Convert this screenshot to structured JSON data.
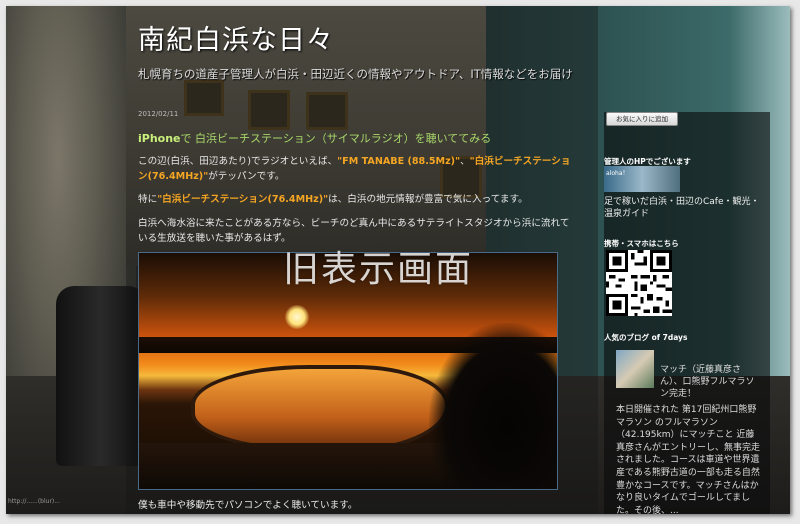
{
  "blog": {
    "title": "南紀白浜な日々",
    "description": "札幌育ちの道産子管理人が白浜・田辺近くの情報やアウトドア、IT情報などをお届け"
  },
  "post": {
    "date": "2012/02/11",
    "title_lead": "iPhone",
    "title_rest": "で 白浜ビーチステーション（サイマルラジオ）を聴いててみる",
    "p1_a": "この辺(白浜、田辺あたり)でラジオといえば、",
    "p1_fm": "\"FM TANABE (88.5Mz)\"",
    "p1_mid": "、",
    "p1_beach": "\"白浜ビーチステーション(76.4MHz)\"",
    "p1_end": "がテッパンです。",
    "p2_a": "特に",
    "p2_beach": "\"白浜ビーチステーション(76.4MHz)\"",
    "p2_end": "は、白浜の地元情報が豊富で気に入ってます。",
    "p3": "白浜へ海水浴に来たことがある方なら、ビーチのど真ん中にあるサテライトスタジオから浜に流れている生放送を聴いた事があるはず。",
    "footer_text": "僕も車中や移動先でパソコンでよく聴いています。",
    "watermark": "旧表示画面"
  },
  "sidebar": {
    "fav_button": "お気に入りに追加",
    "hp_heading": "管理人のHPでございます",
    "hp_banner": "aloha！",
    "hp_text": "足で稼いだ白浜・田辺のCafe・観光・温泉ガイド",
    "mobile_heading": "携帯・スマホはこちら",
    "popular_heading": "人気のブログ of 7days",
    "popular_title": "マッチ（近藤真彦さん）、口熊野フルマラソン完走！",
    "popular_body": "本日開催された 第17回紀州口熊野マラソン のフルマラソン（42.195km）にマッチこと 近藤真彦さんがエントリーし、無事完走されました。コースは車道や世界遺産である熊野古道の一部も走る自然豊かなコースです。マッチさんはかなり良いタイムでゴールしてました。その後、..."
  },
  "status_url": "http://......(blur)...",
  "colors": {
    "link_green": "#a8d86a",
    "highlight_orange": "#f5a623"
  }
}
